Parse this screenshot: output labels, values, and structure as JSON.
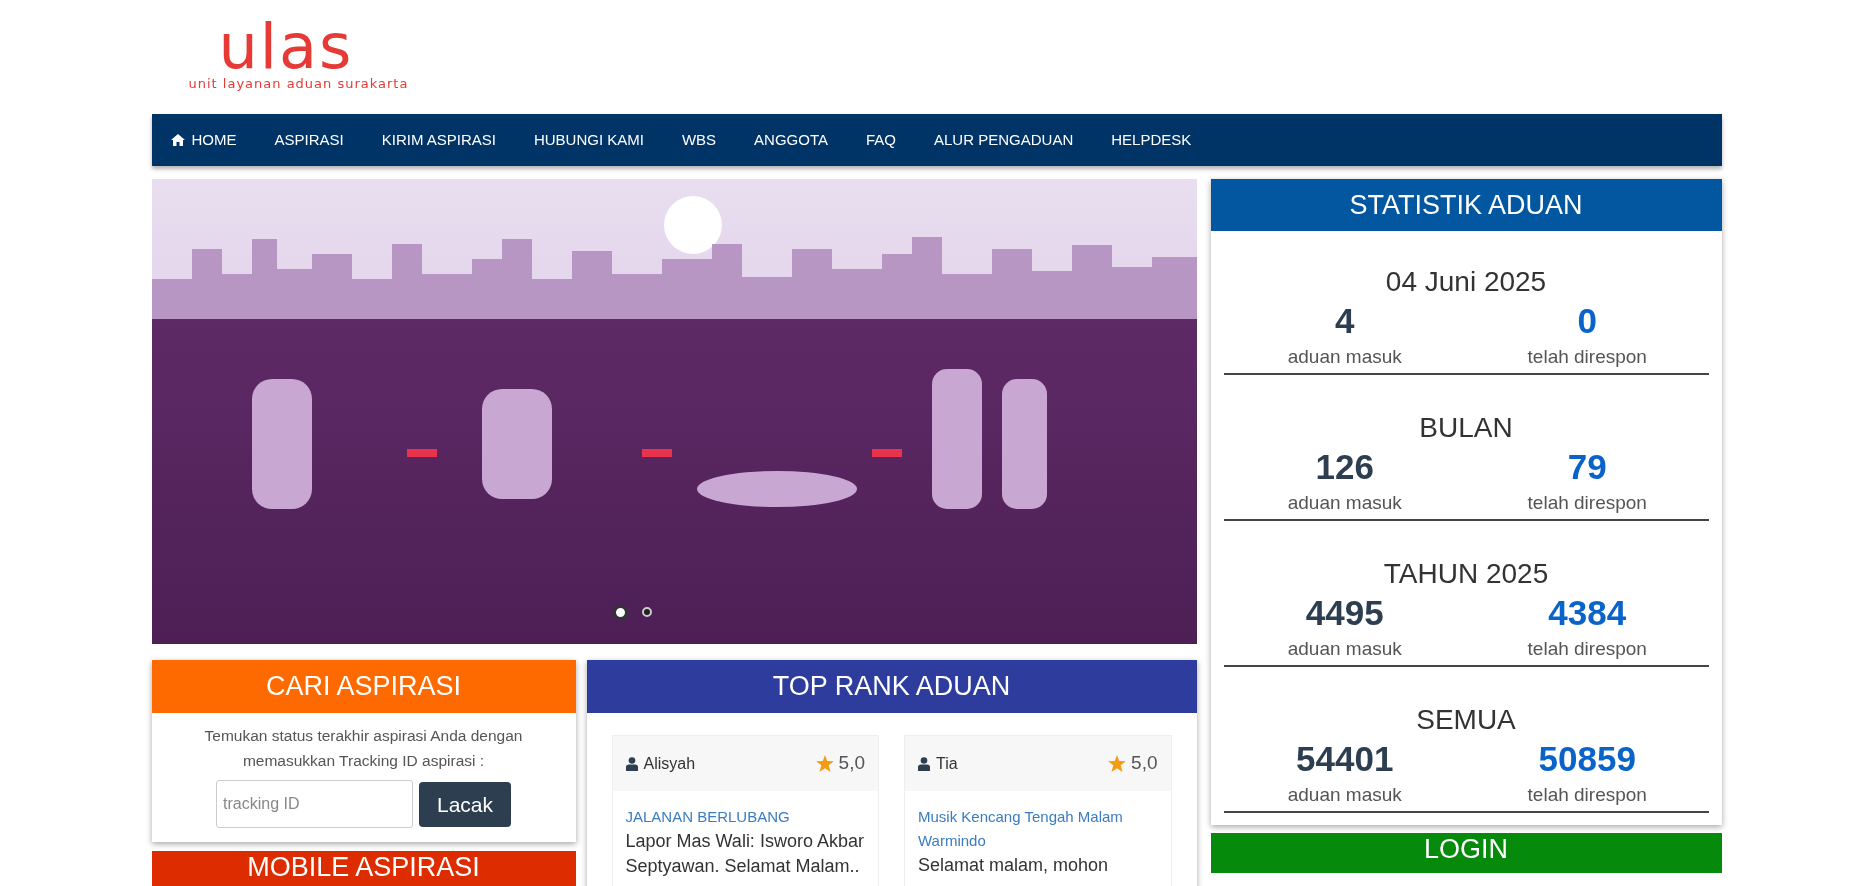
{
  "logo": {
    "wordmark": "ulas",
    "tagline": "unit layanan aduan surakarta"
  },
  "nav": [
    {
      "kind": "home",
      "label": "HOME"
    },
    {
      "kind": "link",
      "label": "ASPIRASI"
    },
    {
      "kind": "link",
      "label": "KIRIM ASPIRASI"
    },
    {
      "kind": "link",
      "label": "HUBUNGI KAMI"
    },
    {
      "kind": "link",
      "label": "WBS"
    },
    {
      "kind": "link",
      "label": "ANGGOTA"
    },
    {
      "kind": "link",
      "label": "FAQ"
    },
    {
      "kind": "link",
      "label": "ALUR PENGADUAN"
    },
    {
      "kind": "link",
      "label": "HELPDESK"
    }
  ],
  "slider": {
    "dots": [
      {
        "selected": true
      },
      {
        "selected": false
      }
    ]
  },
  "search_panel": {
    "title": "CARI ASPIRASI",
    "text": "Temukan status terakhir aspirasi Anda dengan memasukkan Tracking ID aspirasi :",
    "placeholder": "tracking ID",
    "button": "Lacak"
  },
  "top_rank": {
    "title": "TOP RANK ADUAN",
    "cards": [
      {
        "user": "Alisyah",
        "rating": "5,0",
        "category": "JALANAN BERLUBANG",
        "text": "Lapor Mas Wali: Isworo Akbar Septyawan. Selamat Malam.."
      },
      {
        "user": "Tia",
        "rating": "5,0",
        "category": "Musik Kencang Tengah Malam Warmindo",
        "text": "Selamat malam, mohon"
      }
    ]
  },
  "mobile_panel": {
    "title": "MOBILE ASPIRASI"
  },
  "stats": {
    "title": "STATISTIK ADUAN",
    "groups": [
      {
        "period": "04 Juni 2025",
        "received": "4",
        "received_label": "aduan masuk",
        "responded": "0",
        "responded_label": "telah direspon"
      },
      {
        "period": "BULAN",
        "received": "126",
        "received_label": "aduan masuk",
        "responded": "79",
        "responded_label": "telah direspon"
      },
      {
        "period": "TAHUN 2025",
        "received": "4495",
        "received_label": "aduan masuk",
        "responded": "4384",
        "responded_label": "telah direspon"
      },
      {
        "period": "SEMUA",
        "received": "54401",
        "received_label": "aduan masuk",
        "responded": "50859",
        "responded_label": "telah direspon"
      }
    ]
  },
  "login_panel": {
    "title": "LOGIN"
  }
}
